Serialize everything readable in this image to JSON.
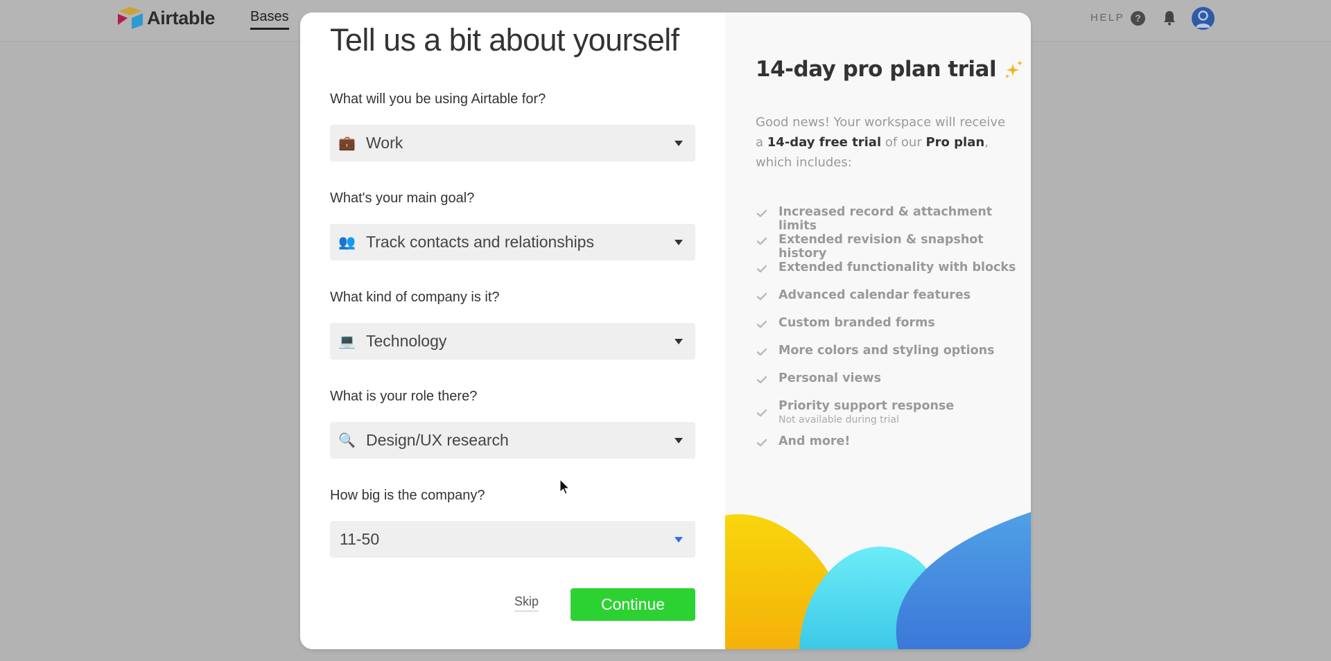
{
  "app": {
    "brand": "Airtable",
    "nav": {
      "bases_label": "Bases"
    },
    "header_right": {
      "help_label": "HELP",
      "help_icon": "question-circle-icon",
      "notifications_icon": "bell-icon",
      "avatar_icon": "user-avatar-icon"
    }
  },
  "modal": {
    "title": "Tell us a bit about yourself",
    "questions": [
      {
        "label": "What will you be using Airtable for?",
        "value": "Work",
        "icon": "briefcase-icon",
        "emoji": "💼"
      },
      {
        "label": "What's your main goal?",
        "value": "Track contacts and relationships",
        "icon": "people-icon",
        "emoji": "👥"
      },
      {
        "label": "What kind of company is it?",
        "value": "Technology",
        "icon": "laptop-icon",
        "emoji": "💻"
      },
      {
        "label": "What is your role there?",
        "value": "Design/UX research",
        "icon": "magnifier-icon",
        "emoji": "🔍"
      },
      {
        "label": "How big is the company?",
        "value": "11-50",
        "icon": "",
        "emoji": ""
      }
    ],
    "skip_label": "Skip",
    "continue_label": "Continue",
    "colors": {
      "continue": "#2cd232",
      "active_caret": "#2d6ee6"
    }
  },
  "trial_panel": {
    "title": "14-day pro plan trial",
    "title_icon": "sparkles-icon",
    "desc_part1": "Good news! Your workspace will receive a ",
    "desc_bold1": "14-day free trial",
    "desc_part2": " of our ",
    "desc_bold2": "Pro plan",
    "desc_part3": ", which includes:",
    "features": [
      {
        "label": "Increased record & attachment limits"
      },
      {
        "label": "Extended revision & snapshot history"
      },
      {
        "label": "Extended functionality with blocks"
      },
      {
        "label": "Advanced calendar features"
      },
      {
        "label": "Custom branded forms"
      },
      {
        "label": "More colors and styling options"
      },
      {
        "label": "Personal views"
      },
      {
        "label": "Priority support response",
        "note": "Not available during trial"
      },
      {
        "label": "And more!"
      }
    ]
  }
}
